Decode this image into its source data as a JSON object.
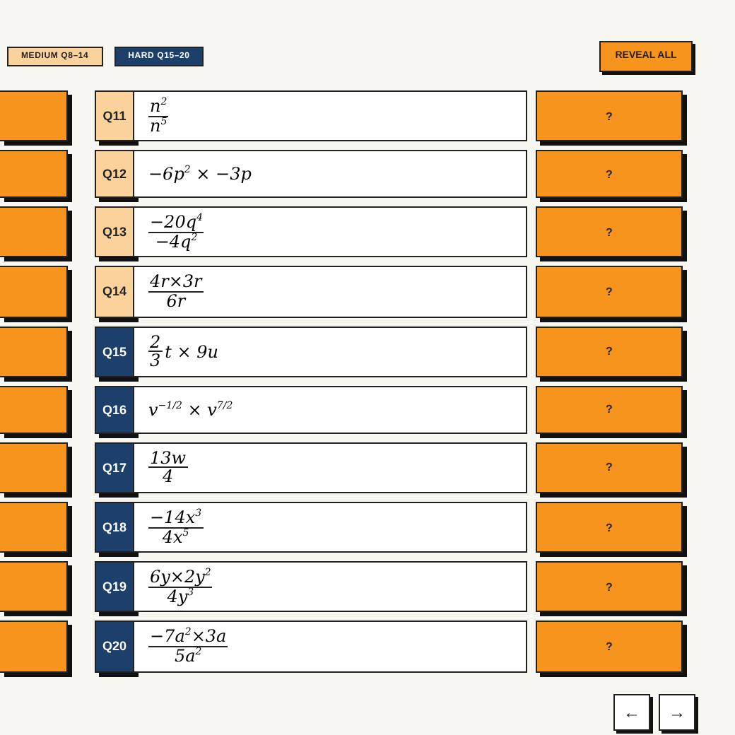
{
  "filters": [
    {
      "label": "MEDIUM Q8–14",
      "color": "#fbd29b"
    },
    {
      "label": "HARD Q15–20",
      "color": "#1c3f6b"
    }
  ],
  "reveal_button": "REVEAL ALL",
  "questions": [
    {
      "label": "Q11",
      "color": "#fbd29b",
      "answer": "?",
      "expression": [
        {
          "kind": "frac",
          "num": "n$^{2}$",
          "den": "n$^{5}$"
        }
      ]
    },
    {
      "label": "Q12",
      "color": "#fbd29b",
      "answer": "?",
      "expression": [
        {
          "kind": "text",
          "text": "−6p$^{2}$ × −3p"
        }
      ]
    },
    {
      "label": "Q13",
      "color": "#fbd29b",
      "answer": "?",
      "expression": [
        {
          "kind": "frac",
          "num": "−20q$^{4}$",
          "den": "−4q$^{2}$"
        }
      ]
    },
    {
      "label": "Q14",
      "color": "#fbd29b",
      "answer": "?",
      "expression": [
        {
          "kind": "frac",
          "num": "4r×3r",
          "den": "6r"
        }
      ]
    },
    {
      "label": "Q15",
      "color": "#1c3f6b",
      "answer": "?",
      "expression": [
        {
          "kind": "frac",
          "num": "2",
          "den": "3"
        },
        {
          "kind": "text",
          "text": "t × 9u"
        }
      ]
    },
    {
      "label": "Q16",
      "color": "#1c3f6b",
      "answer": "?",
      "expression": [
        {
          "kind": "text",
          "text": "v$^{−1/2}$ × v$^{7/2}$"
        }
      ]
    },
    {
      "label": "Q17",
      "color": "#1c3f6b",
      "answer": "?",
      "expression": [
        {
          "kind": "frac",
          "num": "13w",
          "den": "4"
        }
      ]
    },
    {
      "label": "Q18",
      "color": "#1c3f6b",
      "answer": "?",
      "expression": [
        {
          "kind": "frac",
          "num": "−14x$^{3}$",
          "den": "4x$^{5}$"
        }
      ]
    },
    {
      "label": "Q19",
      "color": "#1c3f6b",
      "answer": "?",
      "expression": [
        {
          "kind": "frac",
          "num": "6y×2y$^{2}$",
          "den": "4y$^{3}$"
        }
      ]
    },
    {
      "label": "Q20",
      "color": "#1c3f6b",
      "answer": "?",
      "expression": [
        {
          "kind": "frac",
          "num": "−7a$^{2}$×3a",
          "den": "5a$^{2}$"
        }
      ]
    }
  ],
  "nav": [
    {
      "label": "←"
    },
    {
      "label": "→"
    }
  ]
}
